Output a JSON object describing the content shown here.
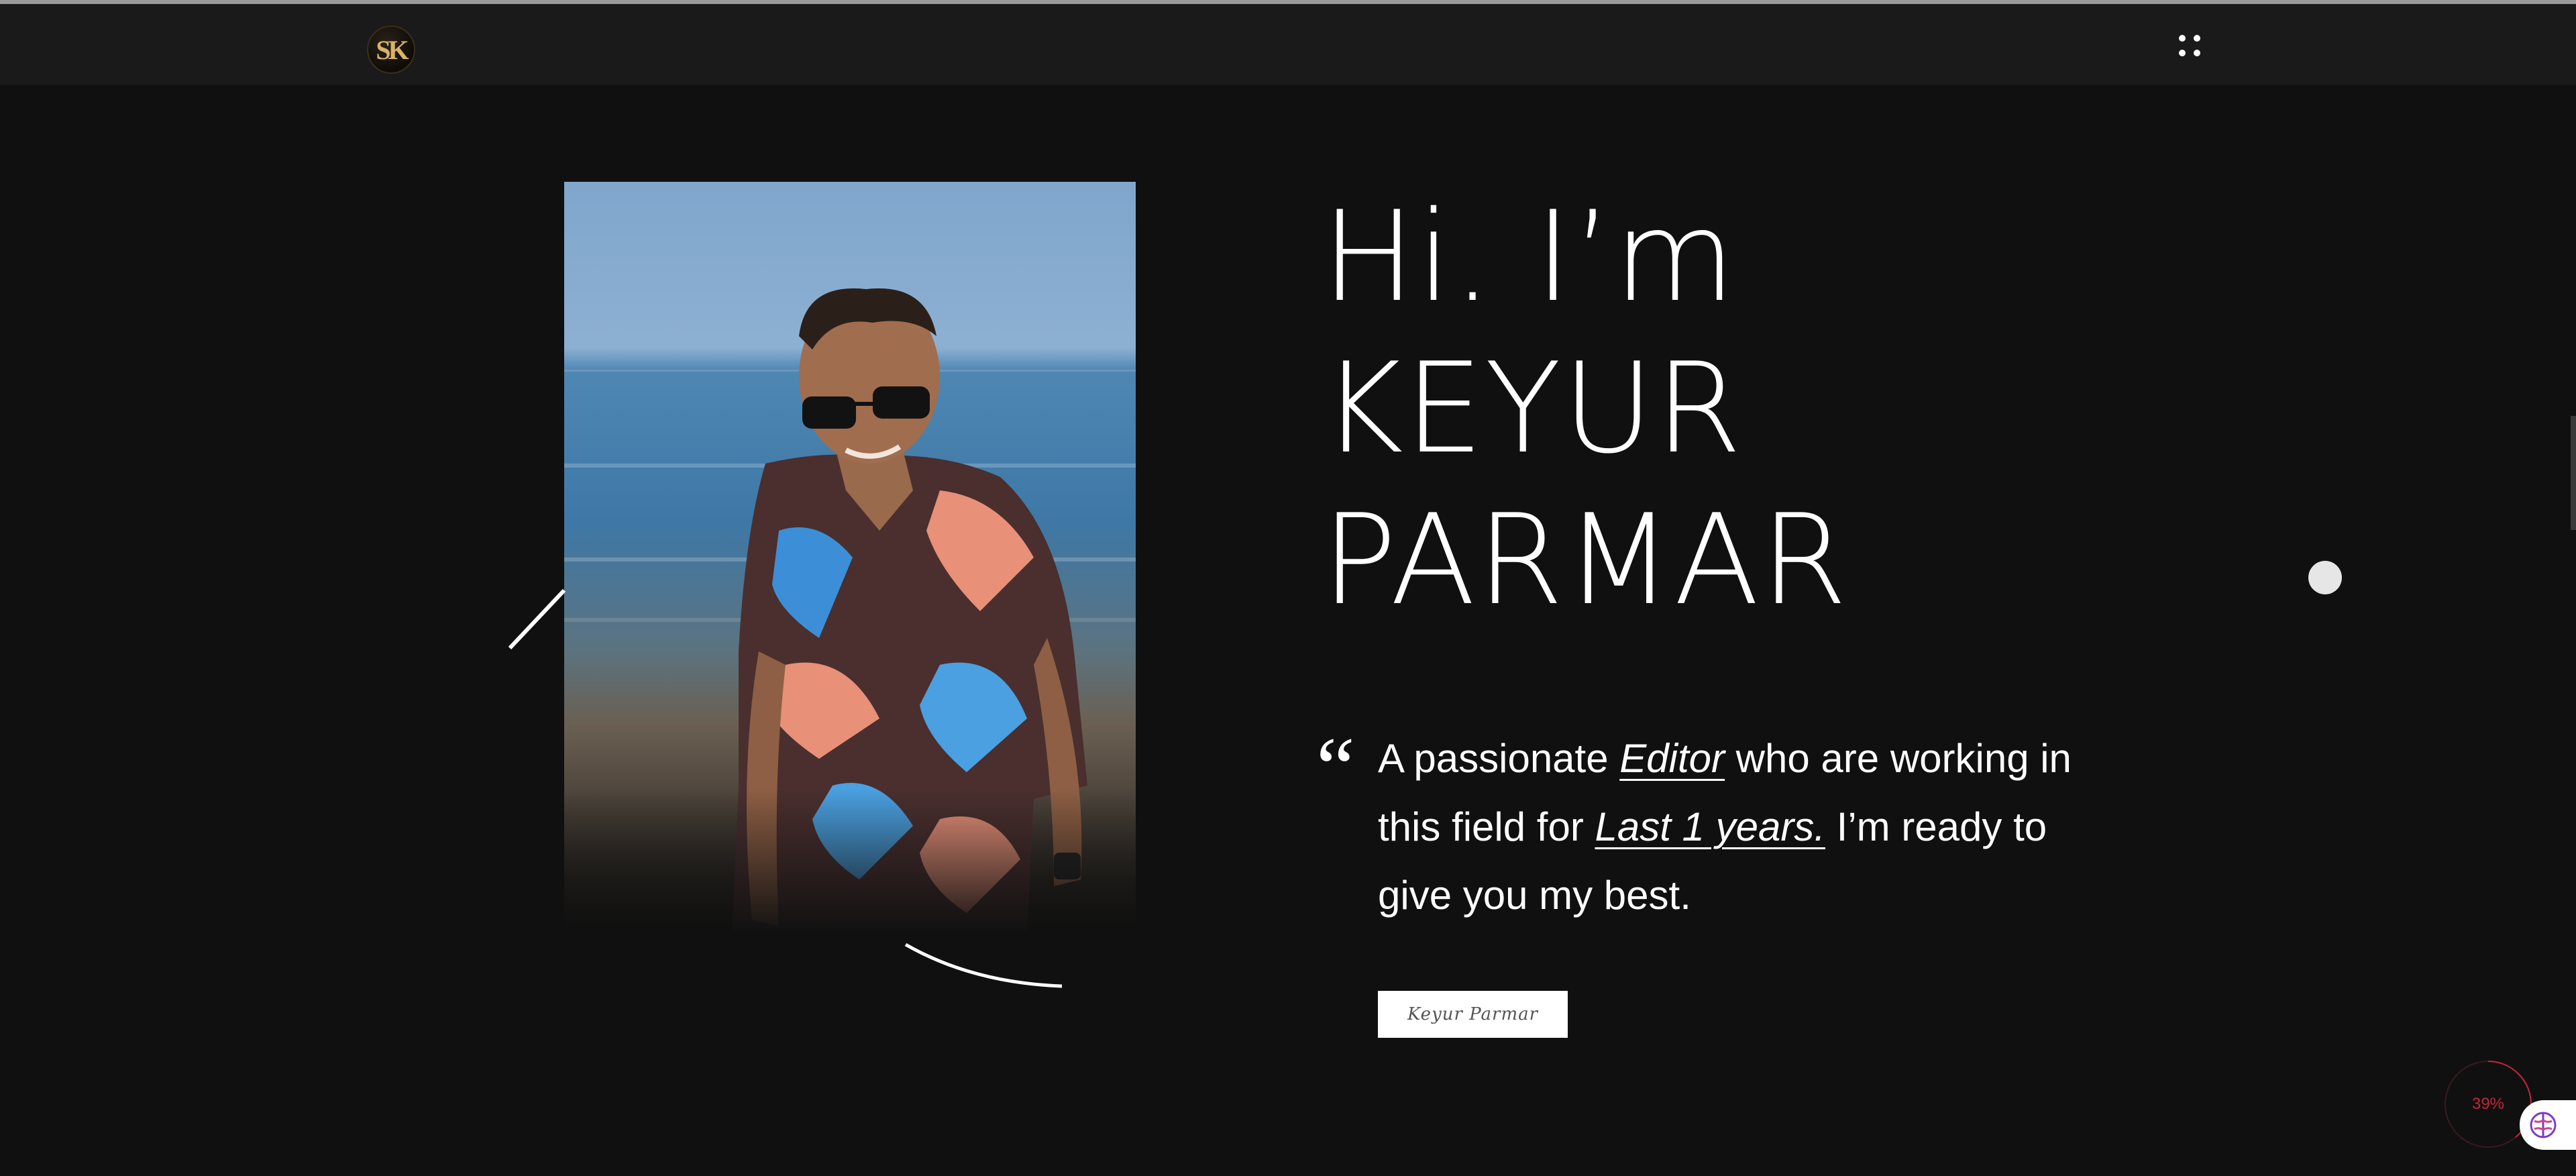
{
  "header": {
    "logo_text": "SK",
    "menu_icon": "grid-dots-icon"
  },
  "hero": {
    "line1": "Hi. I’m",
    "line2": "KEYUR",
    "line3": "PARMAR"
  },
  "bio": {
    "quote_icon": "quote-icon",
    "part1": "A passionate ",
    "emphasis1": "Editor",
    "part2": " who are working in this field for ",
    "emphasis2": "Last 1 years.",
    "part3": " I’m ready to give you my best."
  },
  "signature": {
    "text": "Keyur Parmar"
  },
  "widget": {
    "progress_label": "39%",
    "progress": 0.39,
    "badge_icon": "brain-icon",
    "accent_color": "#c2273c"
  },
  "colors": {
    "background": "#101010",
    "header": "#1a1a1a",
    "text": "#ffffff",
    "logo_gold": "#d9b36a"
  }
}
